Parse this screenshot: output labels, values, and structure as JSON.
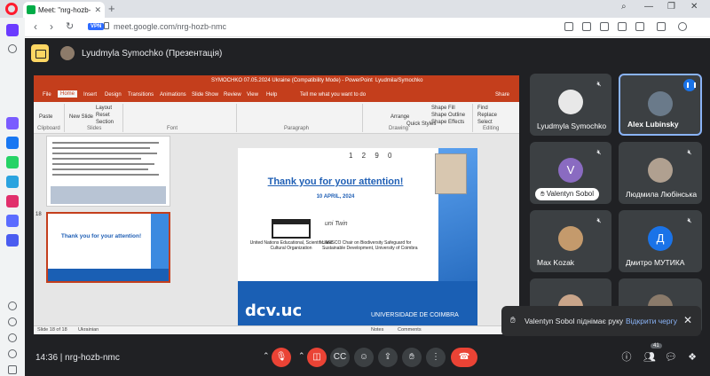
{
  "browser": {
    "tab_title": "Meet: \"nrg-hozb-...",
    "url": "meet.google.com/nrg-hozb-nmc",
    "vpn_label": "VPN"
  },
  "meet": {
    "presenter_banner": "Lyudmyla Symochko (Презентація)",
    "meeting_code": "14:36  |  nrg-hozb-nmc",
    "people_count": "41"
  },
  "powerpoint": {
    "title": "SYMOCHKO 07.05.2024 Ukraine (Compatibility Mode) - PowerPoint",
    "user": "Lyudmila/Symochko",
    "tabs": [
      "File",
      "Home",
      "Insert",
      "Design",
      "Transitions",
      "Animations",
      "Slide Show",
      "Review",
      "View",
      "Help"
    ],
    "tell_me": "Tell me what you want to do",
    "share": "Share",
    "ribbon_groups": [
      "Clipboard",
      "Slides",
      "Font",
      "Paragraph",
      "Drawing",
      "Editing"
    ],
    "ribbon_items": [
      "Paste",
      "New Slide",
      "Layout",
      "Reset",
      "Section",
      "Arrange",
      "Quick Styles",
      "Shape Fill",
      "Shape Outline",
      "Shape Effects",
      "Find",
      "Replace",
      "Select"
    ],
    "thumb_number": "18",
    "thumb_title": "Thank you for your attention!",
    "status_left": "Slide 18 of 18",
    "status_lang": "Ukrainian",
    "status_notes": "Notes",
    "status_comments": "Comments"
  },
  "slide": {
    "logo_text": "1 2 9 0",
    "title": "Thank you for your attention!",
    "date": "10 APRIL, 2024",
    "unesco_text": "United Nations Educational, Scientific and Cultural Organization",
    "chair_text": "UNESCO Chair on Biodiversity Safeguard for Sustainable Development, University of Coimbra",
    "unitwin": "uni Twin",
    "dcv": "dcv.uc",
    "coimbra": "UNIVERSIDADE DE COIMBRA"
  },
  "participants": [
    {
      "name": "Lyudmyla Symochko",
      "color": "#e8e8e8",
      "letter": ""
    },
    {
      "name": "Alex Lubinsky",
      "color": "#6a7a8a",
      "letter": ""
    },
    {
      "name": "Valentyn Sobol",
      "color": "#8a6bc1",
      "letter": "V"
    },
    {
      "name": "Людмила Любінська",
      "color": "#b0a090",
      "letter": ""
    },
    {
      "name": "Max Kozak",
      "color": "#c49a6c",
      "letter": ""
    },
    {
      "name": "Дмитро МУТИКА",
      "color": "#1a73e8",
      "letter": "Д"
    },
    {
      "name": "",
      "color": "#c9a58a",
      "letter": ""
    },
    {
      "name": "",
      "color": "#8a7a6a",
      "letter": ""
    }
  ],
  "toast": {
    "text": "Valentyn Sobol піднімає руку",
    "link": "Відкрити чергу"
  },
  "icons": {
    "mic_off": "mic-off-icon",
    "hand": "raise-hand-icon"
  },
  "colors": {
    "meet_bg": "#202124",
    "tile_bg": "#3c4043",
    "ppt_red": "#c43e1c",
    "hangup": "#ea4335",
    "accent": "#8ab4f8"
  }
}
